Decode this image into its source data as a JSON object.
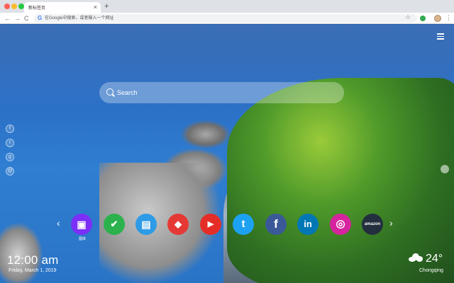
{
  "browser": {
    "tab_title": "新标签页",
    "tab_close": "×",
    "new_tab": "+",
    "back": "←",
    "forward": "→",
    "reload": "C",
    "omnibox_placeholder": "在Google中搜索，或者输入一个网址",
    "bookmark_star": "☆",
    "menu": "⋮"
  },
  "page": {
    "search_placeholder": "Search",
    "side_social": [
      "f",
      "t",
      "g",
      "@"
    ],
    "nav_prev": "‹",
    "nav_next": "›",
    "shortcuts": [
      {
        "icon": "image-gallery-icon",
        "glyph": "▣",
        "color": "#7b2ff7",
        "label": "图库"
      },
      {
        "icon": "checkbox-icon",
        "glyph": "✔",
        "color": "#2bb24c"
      },
      {
        "icon": "document-icon",
        "glyph": "▤",
        "color": "#2e9be6"
      },
      {
        "icon": "game-controller-icon",
        "glyph": "◆",
        "color": "#e53935"
      },
      {
        "icon": "youtube-icon",
        "glyph": "▶",
        "color": "#e52d27"
      },
      {
        "icon": "twitter-icon",
        "glyph": "t",
        "color": "#1da1f2"
      },
      {
        "icon": "facebook-icon",
        "glyph": "f",
        "color": "#3b5998"
      },
      {
        "icon": "linkedin-icon",
        "glyph": "in",
        "color": "#0077b5"
      },
      {
        "icon": "instagram-icon",
        "glyph": "◎",
        "color": "#d6249f"
      },
      {
        "icon": "amazon-icon",
        "glyph": "amazon",
        "color": "#232f3e"
      }
    ],
    "clock": {
      "time": "12:00 am",
      "date": "Friday, March 1, 2019"
    },
    "weather": {
      "temp": "24°",
      "city": "Chongqing"
    }
  }
}
